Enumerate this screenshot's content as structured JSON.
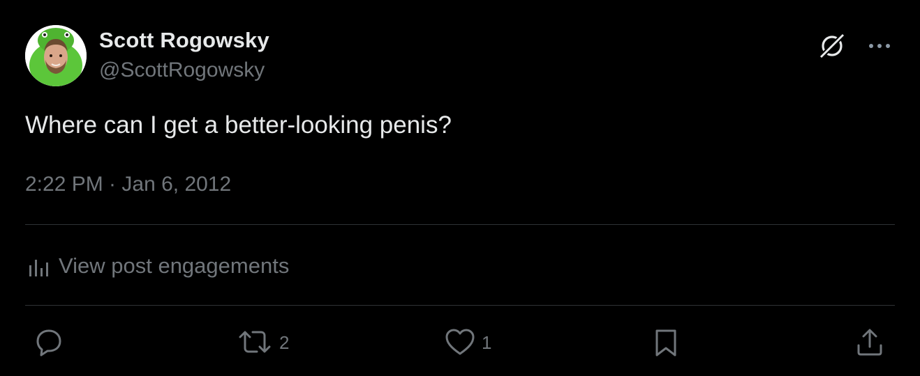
{
  "author": {
    "display_name": "Scott Rogowsky",
    "handle": "@ScottRogowsky",
    "avatar_icon": "avatar-photo"
  },
  "post": {
    "text": "Where can I get a better-looking penis?",
    "timestamp": "2:22 PM · Jan 6, 2012"
  },
  "header_actions": {
    "grok_icon": "grok-icon",
    "more_icon": "more-horizontal-icon"
  },
  "engagements": {
    "label": "View post engagements",
    "icon": "bar-chart-icon"
  },
  "actions": {
    "reply": {
      "icon": "reply-icon",
      "count": ""
    },
    "repost": {
      "icon": "repost-icon",
      "count": "2"
    },
    "like": {
      "icon": "heart-icon",
      "count": "1"
    },
    "bookmark": {
      "icon": "bookmark-icon",
      "count": ""
    },
    "share": {
      "icon": "share-icon",
      "count": ""
    }
  },
  "colors": {
    "background": "#000000",
    "primary_text": "#e7e9ea",
    "secondary_text": "#71767b",
    "divider": "#2f3336",
    "avatar_accent": "#5cc63a"
  }
}
